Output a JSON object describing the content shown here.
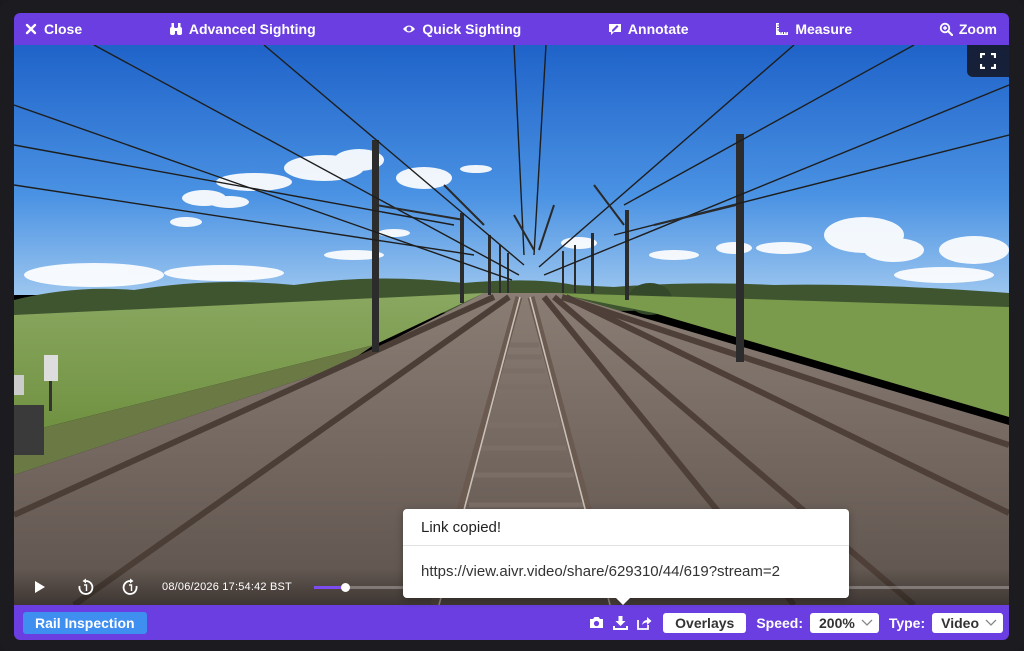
{
  "toolbar": {
    "close_label": "Close",
    "advanced_sighting_label": "Advanced Sighting",
    "quick_sighting_label": "Quick Sighting",
    "annotate_label": "Annotate",
    "measure_label": "Measure",
    "zoom_label": "Zoom"
  },
  "player": {
    "timestamp": "08/06/2026 17:54:42 BST",
    "progress_fraction": 0.045
  },
  "popup": {
    "title": "Link copied!",
    "url": "https://view.aivr.video/share/629310/44/619?stream=2"
  },
  "bottombar": {
    "app_label": "Rail Inspection",
    "overlays_label": "Overlays",
    "speed_label": "Speed:",
    "speed_value": "200%",
    "type_label": "Type:",
    "type_value": "Video"
  },
  "colors": {
    "toolbar_bg": "#6a3ee0",
    "badge_bg": "#3f8ff0",
    "progress_fill": "#7d4df2"
  }
}
